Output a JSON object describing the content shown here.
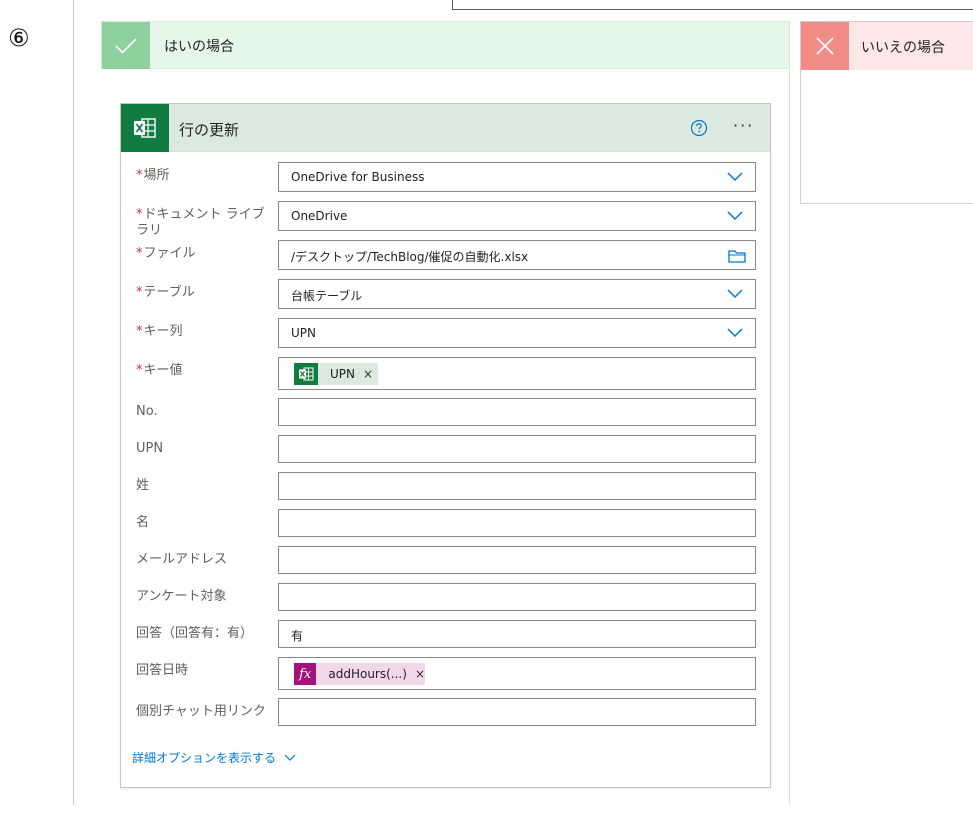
{
  "step_marker": "⑥",
  "yes_branch": {
    "title": "はいの場合",
    "accent": "#8fd19e",
    "background": "#e5f7e8"
  },
  "no_branch": {
    "title": "いいえの場合",
    "accent": "#f28c87",
    "background": "#fde7e9"
  },
  "action": {
    "title": "行の更新",
    "icon": "excel-icon",
    "help_icon": "question-circle-icon",
    "more_label": "···",
    "accent": "#107c41",
    "fields": [
      {
        "label": "場所",
        "required": true,
        "type": "dropdown",
        "value": "OneDrive for Business"
      },
      {
        "label": "ドキュメント ライブラリ",
        "required": true,
        "type": "dropdown",
        "value": "OneDrive"
      },
      {
        "label": "ファイル",
        "required": true,
        "type": "file",
        "value": "/デスクトップ/TechBlog/催促の自動化.xlsx"
      },
      {
        "label": "テーブル",
        "required": true,
        "type": "dropdown",
        "value": "台帳テーブル"
      },
      {
        "label": "キー列",
        "required": true,
        "type": "dropdown",
        "value": "UPN"
      },
      {
        "label": "キー値",
        "required": true,
        "type": "token",
        "token": {
          "label": "UPN",
          "kind": "excel",
          "remove": "×"
        }
      },
      {
        "label": "No.",
        "required": false,
        "type": "text",
        "value": ""
      },
      {
        "label": "UPN",
        "required": false,
        "type": "text",
        "value": ""
      },
      {
        "label": "姓",
        "required": false,
        "type": "text",
        "value": ""
      },
      {
        "label": "名",
        "required": false,
        "type": "text",
        "value": ""
      },
      {
        "label": "メールアドレス",
        "required": false,
        "type": "text",
        "value": ""
      },
      {
        "label": "アンケート対象",
        "required": false,
        "type": "text",
        "value": ""
      },
      {
        "label": "回答（回答有：有）",
        "required": false,
        "type": "text",
        "value": "有"
      },
      {
        "label": "回答日時",
        "required": false,
        "type": "token",
        "token": {
          "label": "addHours(...)",
          "kind": "fx",
          "icon_text": "fx",
          "remove": "×"
        }
      },
      {
        "label": "個別チャット用リンク",
        "required": false,
        "type": "text",
        "value": ""
      }
    ],
    "advanced_options_label": "詳細オプションを表示する"
  },
  "colors": {
    "link": "#0078d4",
    "required_star": "#c4314b",
    "excel_green": "#107c41",
    "fx_magenta": "#a4127a"
  }
}
